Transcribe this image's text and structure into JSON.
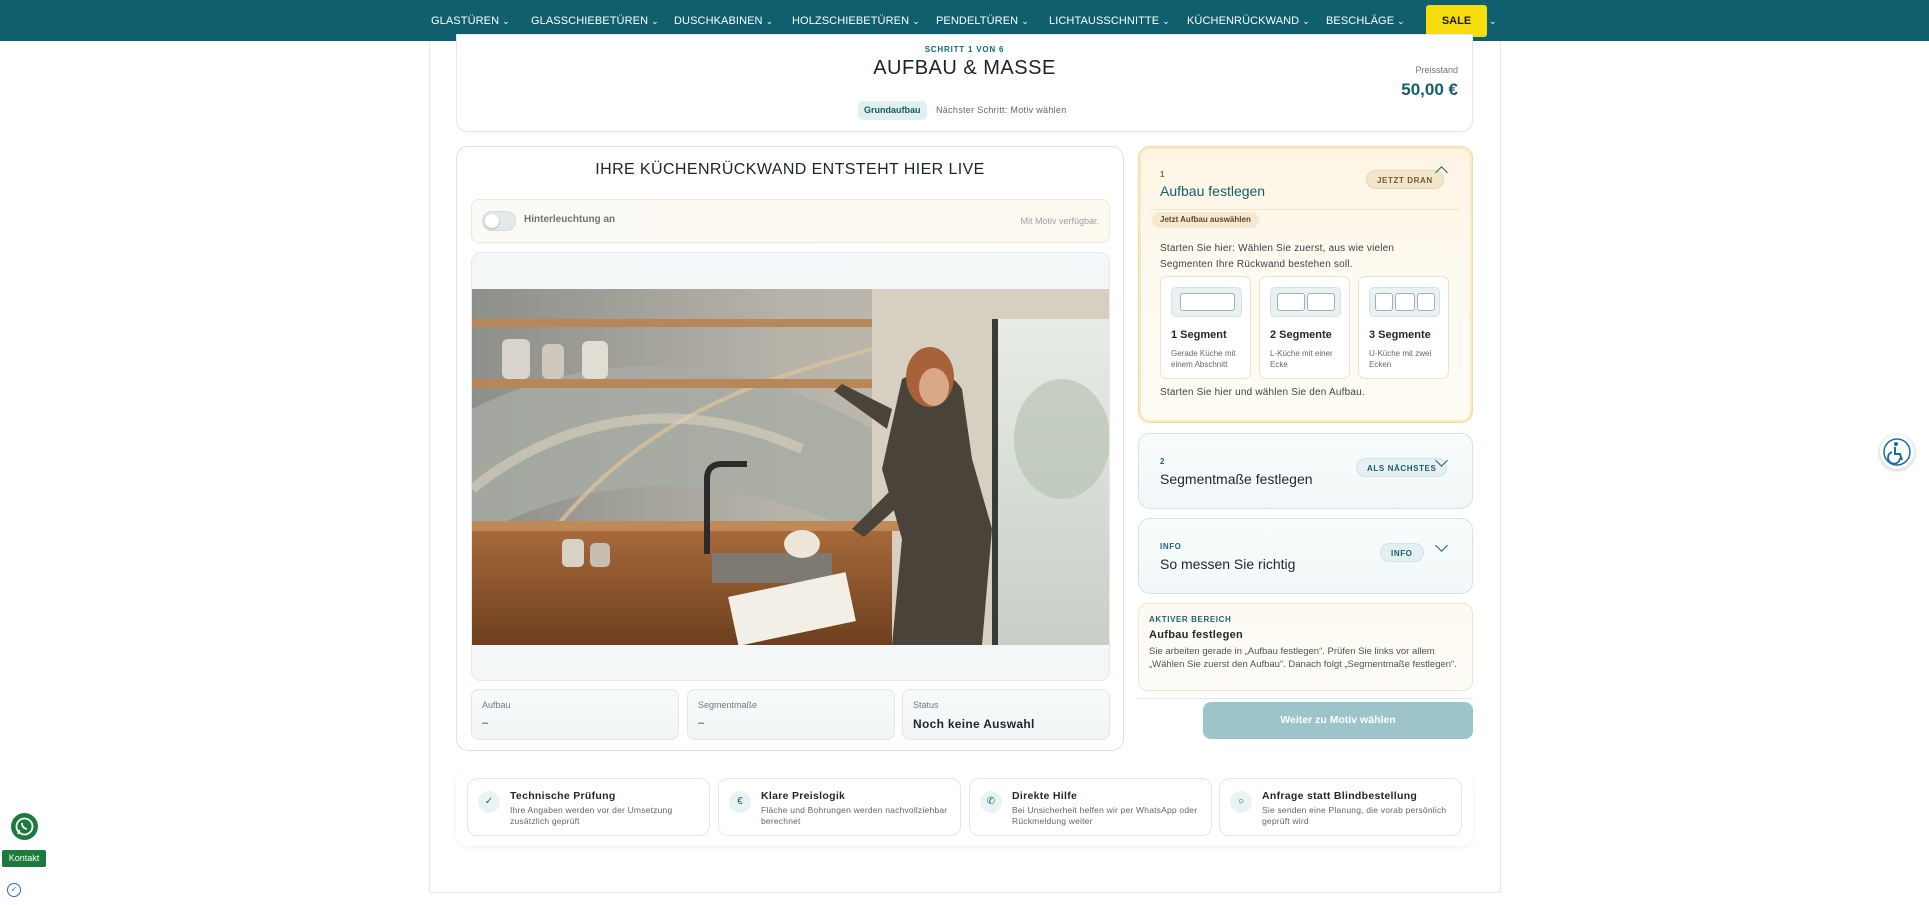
{
  "nav": {
    "items": [
      "GLASTÜREN",
      "GLASSCHIEBETÜREN",
      "DUSCHKABINEN",
      "HOLZSCHIEBETÜREN",
      "PENDELTÜREN",
      "LICHTAUSSCHNITTE",
      "KÜCHENRÜCKWAND",
      "BESCHLÄGE"
    ],
    "sale_label": "SALE",
    "chevron_icon": "chevron-down-icon",
    "bar_color": "#0f5f6e",
    "sale_color": "#f7dc0e"
  },
  "header": {
    "step_kicker": "SCHRITT 1 VON 6",
    "title": "AUFBAU & MASSE",
    "chip": "Grundaufbau",
    "next_step": "Nächster Schritt: Motiv wählen",
    "price_label": "Preisstand",
    "price_value": "50,00 €"
  },
  "preview": {
    "title": "IHRE KÜCHENRÜCKWAND ENTSTEHT HIER LIVE",
    "lighting_label": "Hinterleuchtung an",
    "lighting_on": false,
    "lighting_note": "Mit Motiv verfügbar.",
    "info": [
      {
        "label": "Aufbau",
        "value": "–"
      },
      {
        "label": "Segmentmaße",
        "value": "–"
      },
      {
        "label": "Status",
        "value": "Noch keine Auswahl"
      }
    ]
  },
  "steps": {
    "step1": {
      "number": "1",
      "title": "Aufbau festlegen",
      "badge": "JETZT DRAN",
      "sub_chip": "Jetzt Aufbau auswählen",
      "intro": "Starten Sie hier: Wählen Sie zuerst, aus wie vielen Segmenten Ihre Rückwand bestehen soll.",
      "options": [
        {
          "name": "1 Segment",
          "desc": "Gerade Küche mit einem Abschnitt"
        },
        {
          "name": "2 Segmente",
          "desc": "L-Küche mit einer Ecke"
        },
        {
          "name": "3 Segmente",
          "desc": "U-Küche mit zwei Ecken"
        }
      ],
      "footer": "Starten Sie hier und wählen Sie den Aufbau."
    },
    "step2": {
      "number": "2",
      "title": "Segmentmaße festlegen",
      "badge": "ALS NÄCHSTES"
    },
    "info": {
      "number": "INFO",
      "title": "So messen Sie richtig",
      "badge": "INFO"
    }
  },
  "active": {
    "kicker": "AKTIVER BEREICH",
    "title": "Aufbau festlegen",
    "desc": "Sie arbeiten gerade in „Aufbau festlegen“. Prüfen Sie links vor allem „Wählen Sie zuerst den Aufbau“. Danach folgt „Segmentmaße festlegen“."
  },
  "cta_label": "Weiter zu Motiv wählen",
  "trust": [
    {
      "icon": "check-icon",
      "glyph": "✓",
      "title": "Technische Prüfung",
      "desc": "Ihre Angaben werden vor der Umsetzung zusätzlich geprüft"
    },
    {
      "icon": "euro-icon",
      "glyph": "€",
      "title": "Klare Preislogik",
      "desc": "Fläche und Bohrungen werden nachvollziehbar berechnet"
    },
    {
      "icon": "support-icon",
      "glyph": "✆",
      "title": "Direkte Hilfe",
      "desc": "Bei Unsicherheit helfen wir per WhatsApp oder Rückmeldung weiter"
    },
    {
      "icon": "circle-icon",
      "glyph": "○",
      "title": "Anfrage statt Blindbestellung",
      "desc": "Sie senden eine Planung, die vorab persönlich geprüft wird"
    }
  ],
  "floating": {
    "kontakt_label": "Kontakt",
    "accessibility_icon": "accessibility-icon",
    "whatsapp_icon": "whatsapp-icon"
  }
}
